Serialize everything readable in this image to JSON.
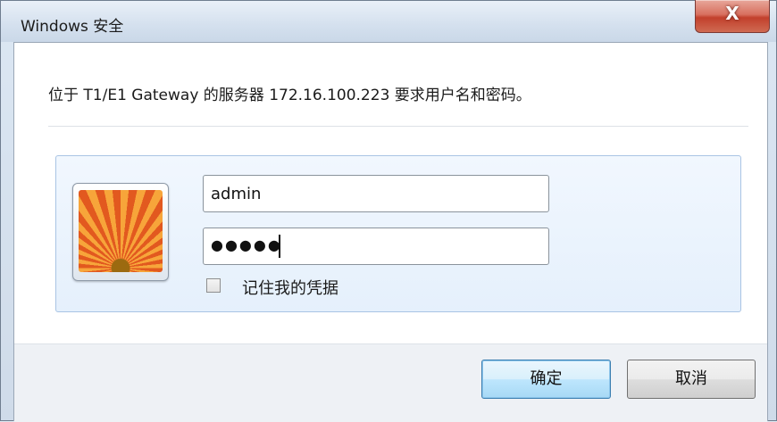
{
  "window": {
    "title": "Windows 安全",
    "close_label": "X"
  },
  "message": "位于 T1/E1 Gateway 的服务器 172.16.100.223 要求用户名和密码。",
  "credentials": {
    "username_value": "admin",
    "password_masked": "●●●●●",
    "remember_label": "记住我的凭据",
    "remember_checked": false
  },
  "buttons": {
    "ok_label": "确定",
    "cancel_label": "取消"
  },
  "colors": {
    "accent": "#3c7fb1",
    "close_red": "#c2402c",
    "panel_bg": "#e5f0fc"
  }
}
